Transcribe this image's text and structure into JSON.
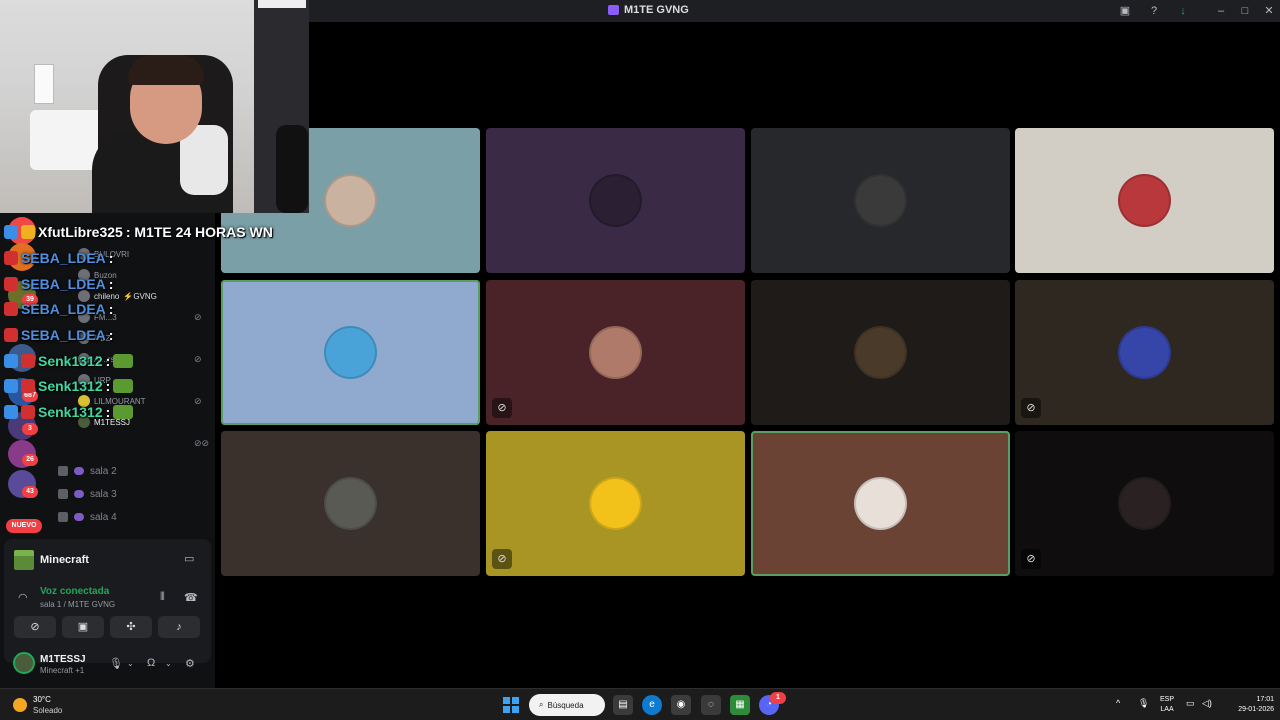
{
  "window": {
    "title": "M1TE GVNG",
    "controls": [
      "inbox-icon",
      "help-icon",
      "download-icon",
      "minimize-icon",
      "maximize-icon",
      "close-icon"
    ]
  },
  "server_badges": [
    "39",
    "687",
    "3",
    "26",
    "43"
  ],
  "new_label": "NUEVO",
  "channel_members": [
    {
      "name": "BULOVRI"
    },
    {
      "name": "Buzon"
    },
    {
      "name": "chileno",
      "tag": "⚡GVNG"
    },
    {
      "name": "FM...3"
    },
    {
      "name": "f",
      "tag": "EZ"
    },
    {
      "name": "Al...rs"
    },
    {
      "name": "URP"
    },
    {
      "name": "LILMOURANT"
    },
    {
      "name": "M1TESSJ"
    }
  ],
  "voice_channels": [
    "sala 2",
    "sala 3",
    "sala 4"
  ],
  "activity": {
    "name": "Minecraft"
  },
  "voice": {
    "status": "Voz conectada",
    "channel": "sala 1 / M1TE GVNG"
  },
  "user": {
    "name": "M1TESSJ",
    "status": "Minecraft +1"
  },
  "chat": [
    {
      "user": "XfutLibre325",
      "message": " : M1TE 24 HORAS WN",
      "color": "#ffffff"
    },
    {
      "user": "SEBA_LDEA",
      "message": " :",
      "color": "#4f8fe0"
    },
    {
      "user": "SEBA_LDEA",
      "message": " :",
      "color": "#4f8fe0"
    },
    {
      "user": "SEBA_LDEA",
      "message": " :",
      "color": "#4f8fe0"
    },
    {
      "user": "SEBA_LDEA",
      "message": " :",
      "color": "#4f8fe0"
    },
    {
      "user": "Senk1312",
      "message": " :",
      "color": "#3fd8a0"
    },
    {
      "user": "Senk1312",
      "message": " :",
      "color": "#3fd8a0"
    },
    {
      "user": "Senk1312",
      "message": " :",
      "color": "#3fd8a0"
    }
  ],
  "tiles": [
    {
      "bg": "#7a9fa6",
      "avatar": "#c9b3a0",
      "muted": false,
      "speaking": false
    },
    {
      "bg": "#3a2a45",
      "avatar": "#2a1f33",
      "muted": false,
      "speaking": false
    },
    {
      "bg": "#27282b",
      "avatar": "#3a3a3a",
      "muted": false,
      "speaking": false
    },
    {
      "bg": "#d2cdc5",
      "avatar": "#b8383c",
      "muted": false,
      "speaking": false
    },
    {
      "bg": "#8fa9cf",
      "avatar": "#4aa3d8",
      "muted": false,
      "speaking": true
    },
    {
      "bg": "#4a2328",
      "avatar": "#b07a6a",
      "muted": true,
      "speaking": false
    },
    {
      "bg": "#1e1b18",
      "avatar": "#4a3a2a",
      "muted": false,
      "speaking": false
    },
    {
      "bg": "#2f2821",
      "avatar": "#3545a8",
      "muted": true,
      "speaking": false
    },
    {
      "bg": "#3a302c",
      "avatar": "#5a5a55",
      "muted": false,
      "speaking": false
    },
    {
      "bg": "#a89524",
      "avatar": "#f2c21a",
      "muted": true,
      "speaking": false
    },
    {
      "bg": "#6a4335",
      "avatar": "#e8e0d8",
      "muted": false,
      "speaking": true
    },
    {
      "bg": "#0f0d0d",
      "avatar": "#2a2222",
      "muted": true,
      "speaking": false
    }
  ],
  "taskbar": {
    "temp": "30°C",
    "weather": "Soleado",
    "search": "Búsqueda",
    "lang_top": "ESP",
    "lang_bottom": "LAA",
    "time": "17:01",
    "date": "29-01-2026",
    "discord_badge": "1"
  }
}
